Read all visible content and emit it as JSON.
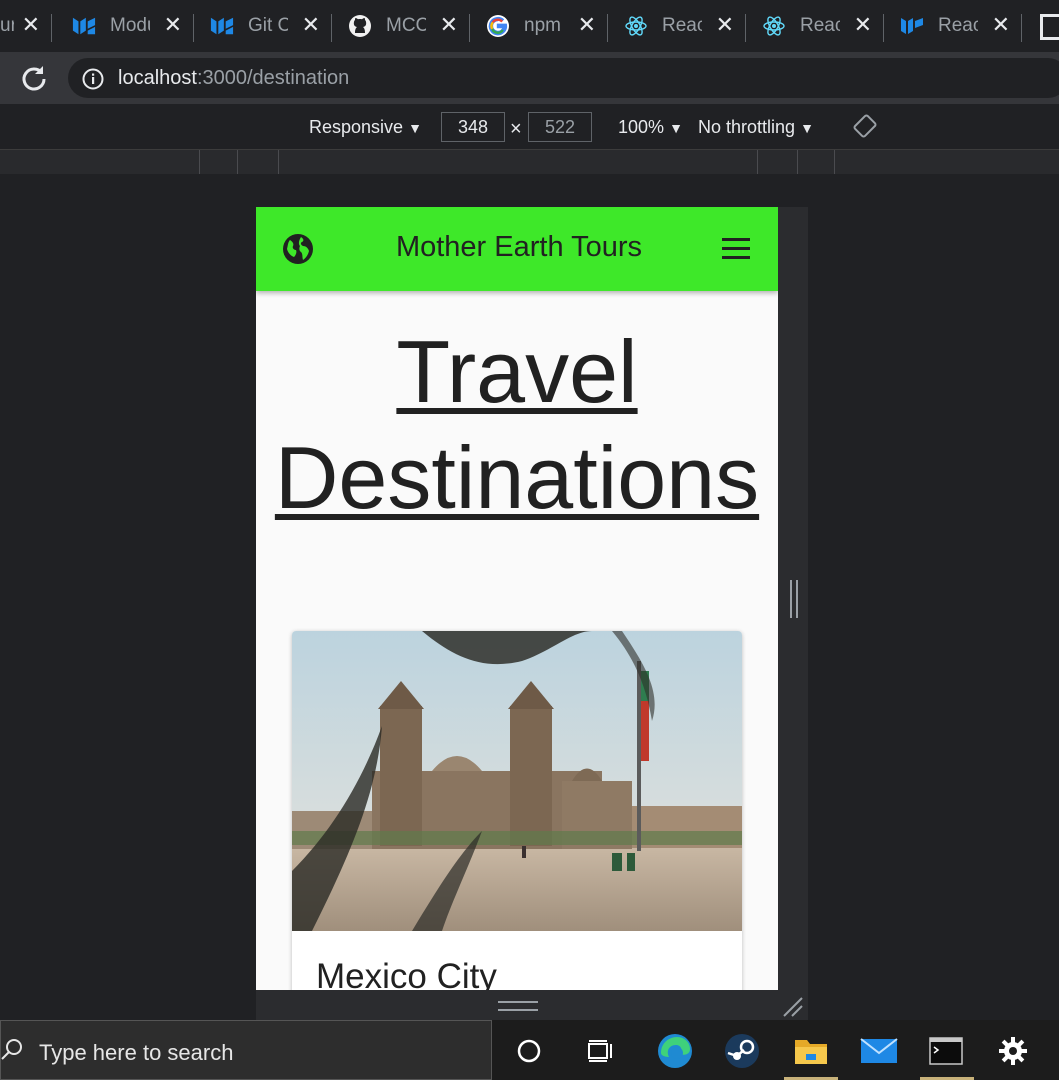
{
  "tabs": [
    {
      "title": "urs",
      "icon": "page-icon"
    },
    {
      "title": "Modu",
      "icon": "mui-icon"
    },
    {
      "title": "Git Cl",
      "icon": "mui-icon"
    },
    {
      "title": "MCCI",
      "icon": "github-icon"
    },
    {
      "title": "npm",
      "icon": "google-icon"
    },
    {
      "title": "React",
      "icon": "react-icon"
    },
    {
      "title": "React",
      "icon": "react-icon"
    },
    {
      "title": "React",
      "icon": "mui-icon"
    }
  ],
  "address_bar": {
    "host": "localhost",
    "path": ":3000/destination"
  },
  "device_toolbar": {
    "device": "Responsive",
    "width": "348",
    "height": "522",
    "times": "×",
    "zoom": "100%",
    "throttling": "No throttling"
  },
  "app": {
    "title": "Mother Earth Tours",
    "heading_line1": "Travel",
    "heading_line2": "Destinations",
    "cards": [
      {
        "title": "Mexico City",
        "image": "Metropolitan Cathedral, Zócalo, Mexico City"
      }
    ]
  },
  "taskbar": {
    "search_placeholder": "Type here to search",
    "apps": [
      "cortana-icon",
      "task-view-icon",
      "edge-icon",
      "steam-icon",
      "file-explorer-icon",
      "mail-icon",
      "terminal-icon",
      "settings-icon"
    ]
  },
  "colors": {
    "appbar": "#3ee829",
    "browser_bg": "#202124"
  }
}
